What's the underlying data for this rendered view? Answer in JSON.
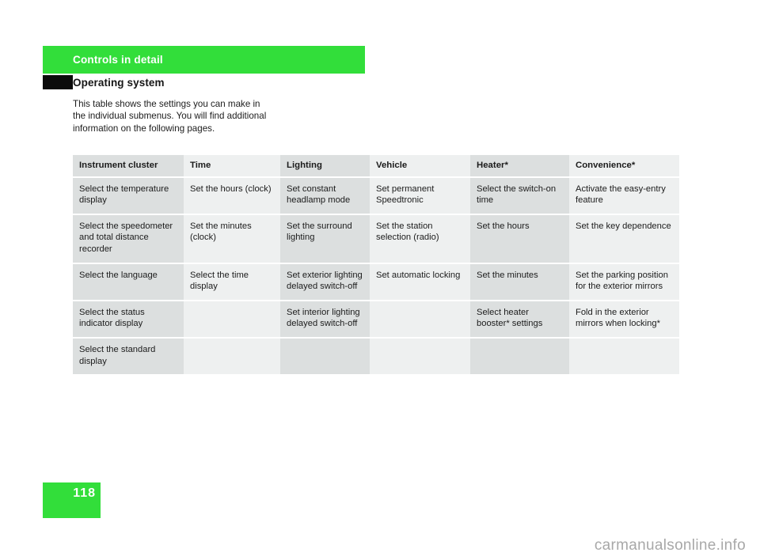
{
  "header": {
    "band_title": "Controls in detail",
    "band_color": "#32de3a",
    "marker_color": "#0b0b0b",
    "section_heading": "Operating system"
  },
  "intro": {
    "text": "This table shows the settings you can make in the individual submenus. You will find additional information on the following pages."
  },
  "table": {
    "columns": [
      "Instrument cluster",
      "Time",
      "Lighting",
      "Vehicle",
      "Heater*",
      "Convenience*"
    ],
    "rows": [
      [
        "Select the temperature display",
        "Set the hours (clock)",
        "Set constant headlamp mode",
        "Set permanent Speedtronic",
        "Select the switch-on time",
        "Activate the easy-entry feature"
      ],
      [
        "Select the speedometer and total distance recorder",
        "Set the minutes (clock)",
        "Set the surround lighting",
        "Set the station selection (radio)",
        "Set the hours",
        "Set the key dependence"
      ],
      [
        "Select the language",
        "Select the time display",
        "Set exterior lighting delayed switch-off",
        "Set automatic locking",
        "Set the minutes",
        "Set the parking position for the exterior mirrors"
      ],
      [
        "Select the status indicator display",
        "",
        "Set interior lighting delayed switch-off",
        "",
        "Select heater booster* settings",
        "Fold in the exterior mirrors when locking*"
      ],
      [
        "Select the standard display",
        "",
        "",
        "",
        "",
        ""
      ]
    ],
    "shade_dark": "#dcdfdf",
    "shade_light": "#eef0f0"
  },
  "footer": {
    "page_number": "118",
    "page_block_color": "#32de3a",
    "watermark": "carmanualsonline.info"
  }
}
